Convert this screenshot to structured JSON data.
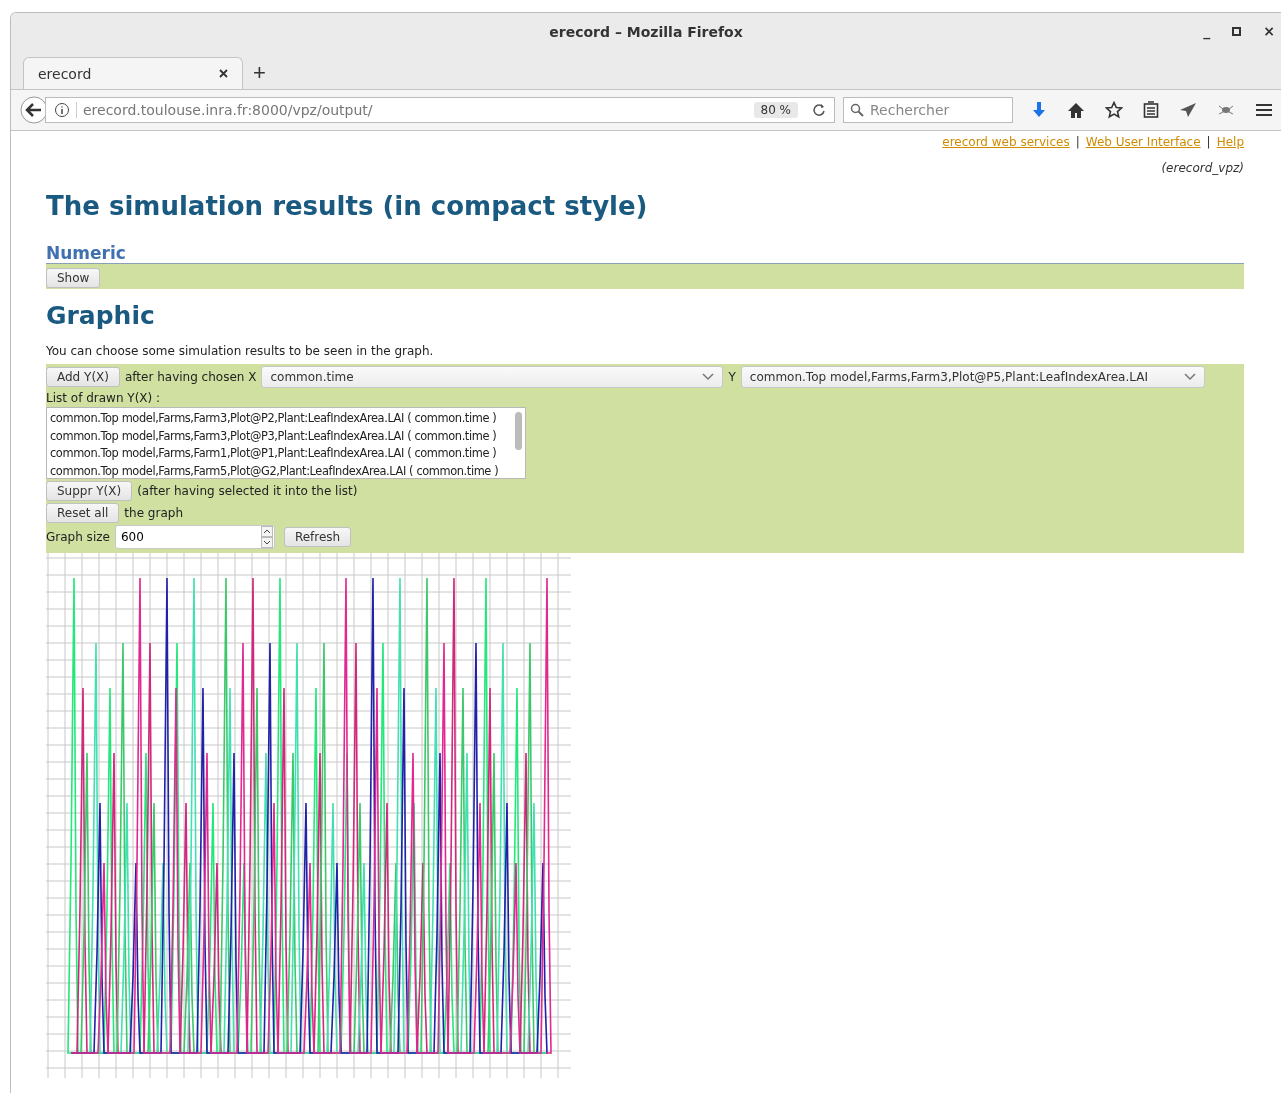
{
  "window": {
    "title": "erecord – Mozilla Firefox",
    "controls": [
      "_",
      "×"
    ]
  },
  "tabs": [
    {
      "label": "erecord",
      "selected": true
    }
  ],
  "new_tab": "+",
  "nav": {
    "url": "erecord.toulouse.inra.fr:8000/vpz/output/",
    "zoom": "80 %",
    "search_placeholder": "Rechercher"
  },
  "header_links": [
    "erecord web services",
    "Web User Interface",
    "Help"
  ],
  "header_separators": [
    "|",
    "|"
  ],
  "subtitle": "(erecord_vpz)",
  "heading": "The simulation results (in compact style)",
  "numeric": {
    "title": "Numeric",
    "button": "Show"
  },
  "graphic": {
    "title": "Graphic",
    "intro": "You can choose some simulation results to be seen in the graph.",
    "add_button": "Add Y(X)",
    "after_x": "after having chosen X",
    "x_select": "common.time",
    "y_label": "Y",
    "y_select": "common.Top model,Farms,Farm3,Plot@P5,Plant:LeafIndexArea.LAI",
    "list_label": "List of drawn Y(X) :",
    "list_items": [
      "common.Top model,Farms,Farm3,Plot@P2,Plant:LeafIndexArea.LAI ( common.time )",
      "common.Top model,Farms,Farm3,Plot@P3,Plant:LeafIndexArea.LAI ( common.time )",
      "common.Top model,Farms,Farm1,Plot@P1,Plant:LeafIndexArea.LAI ( common.time )",
      "common.Top model,Farms,Farm5,Plot@G2,Plant:LeafIndexArea.LAI ( common.time )"
    ],
    "suppr_button": "Suppr Y(X)",
    "suppr_note": "(after having selected it into the list)",
    "reset_button": "Reset all",
    "reset_note": "the graph",
    "size_label": "Graph size",
    "size_value": "600",
    "refresh_button": "Refresh"
  }
}
